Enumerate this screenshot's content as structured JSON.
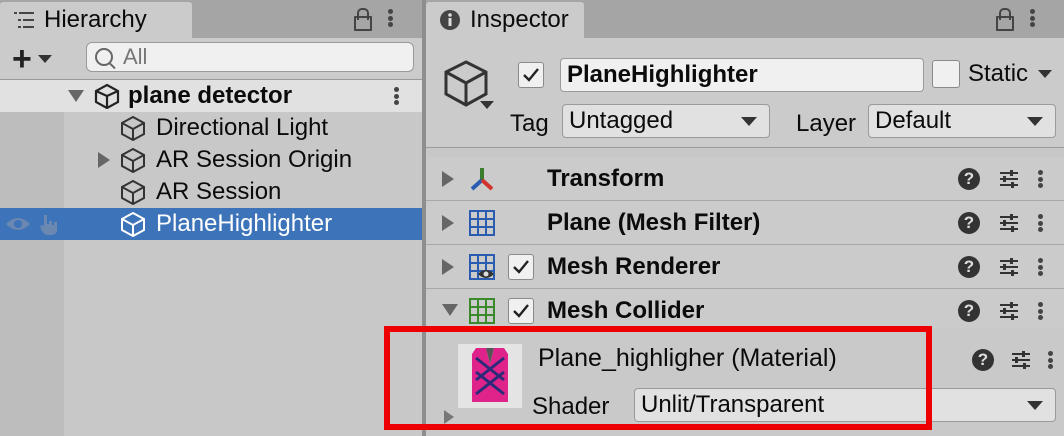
{
  "hierarchy": {
    "tab_label": "Hierarchy",
    "search_placeholder": "All",
    "add_label": "+",
    "scene": "plane detector",
    "items": [
      {
        "label": "Directional Light",
        "expandable": false
      },
      {
        "label": "AR Session Origin",
        "expandable": true
      },
      {
        "label": "AR Session",
        "expandable": false
      },
      {
        "label": "PlaneHighlighter",
        "expandable": false,
        "selected": true
      }
    ]
  },
  "inspector": {
    "tab_label": "Inspector",
    "object_name": "PlaneHighlighter",
    "static_label": "Static",
    "tag_label": "Tag",
    "tag_value": "Untagged",
    "layer_label": "Layer",
    "layer_value": "Default",
    "components": [
      {
        "name": "Transform",
        "icon": "transform-icon"
      },
      {
        "name": "Plane (Mesh Filter)",
        "icon": "mesh-filter-icon"
      },
      {
        "name": "Mesh Renderer",
        "icon": "mesh-renderer-icon",
        "enabled": true
      },
      {
        "name": "Mesh Collider",
        "icon": "mesh-collider-icon",
        "enabled": true,
        "expanded": true
      }
    ],
    "material": {
      "name": "Plane_highligher (Material)",
      "shader_label": "Shader",
      "shader_value": "Unlit/Transparent"
    }
  },
  "colors": {
    "selection": "#3c73b9",
    "highlight_box": "#ee0000",
    "panel_bg": "#c8c8c8"
  }
}
